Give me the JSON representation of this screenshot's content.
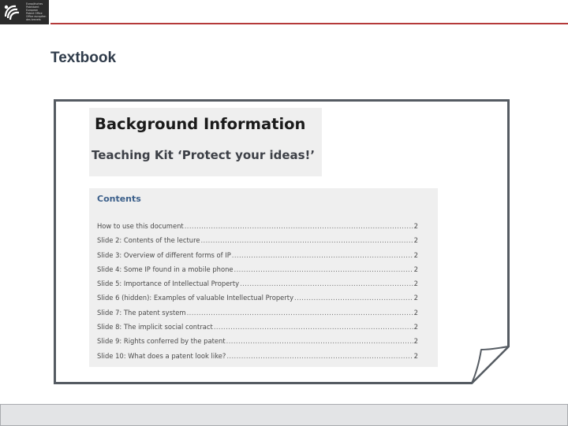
{
  "header": {
    "logo": {
      "icon": "epo-logo-icon",
      "lines": [
        "Europäisches",
        "Patentamt",
        "European",
        "Patent Office",
        "Office européen",
        "des brevets"
      ]
    },
    "accent_color": "#b53a3a"
  },
  "slide": {
    "title": "Textbook"
  },
  "document": {
    "title": "Background Information",
    "subtitle": "Teaching Kit ‘Protect your ideas!’",
    "contents": {
      "heading": "Contents",
      "entries": [
        {
          "label": "How to use this document",
          "page": "2"
        },
        {
          "label": "Slide 2: Contents of the lecture",
          "page": "2"
        },
        {
          "label": "Slide 3: Overview of different forms of IP",
          "page": "2"
        },
        {
          "label": "Slide 4: Some IP found in a mobile phone",
          "page": "2"
        },
        {
          "label": "Slide 5: Importance of Intellectual Property",
          "page": "2"
        },
        {
          "label": "Slide 6 (hidden): Examples of valuable Intellectual Property",
          "page": "2"
        },
        {
          "label": "Slide 7: The patent system",
          "page": "2"
        },
        {
          "label": "Slide 8: The implicit social contract",
          "page": "2"
        },
        {
          "label": "Slide 9: Rights conferred by the patent",
          "page": "2"
        },
        {
          "label": "Slide 10: What does a patent look like?",
          "page": "2"
        }
      ]
    }
  },
  "footer": {}
}
